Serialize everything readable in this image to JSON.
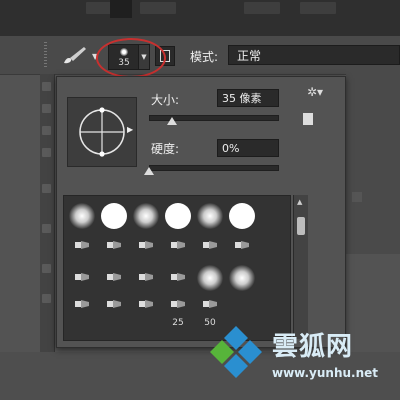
{
  "options_bar": {
    "brush_size_value": "35",
    "mode_label": "模式:",
    "mode_value": "正常"
  },
  "brush_panel": {
    "size_label": "大小:",
    "size_value": "35 像素",
    "size_slider_fraction": 0.18,
    "hardness_label": "硬度:",
    "hardness_value": "0%",
    "hardness_slider_fraction": 0.0,
    "preset_labels": [
      "25",
      "50"
    ],
    "icons": [
      "brush-icon",
      "gear-icon",
      "new-preset-icon"
    ]
  },
  "watermark": {
    "title": "雲狐网",
    "url": "www.yunhu.net"
  },
  "colors": {
    "highlight_ring": "#c8302f",
    "panel_bg": "#535353",
    "watermark_blue": "#2a8fd0"
  }
}
